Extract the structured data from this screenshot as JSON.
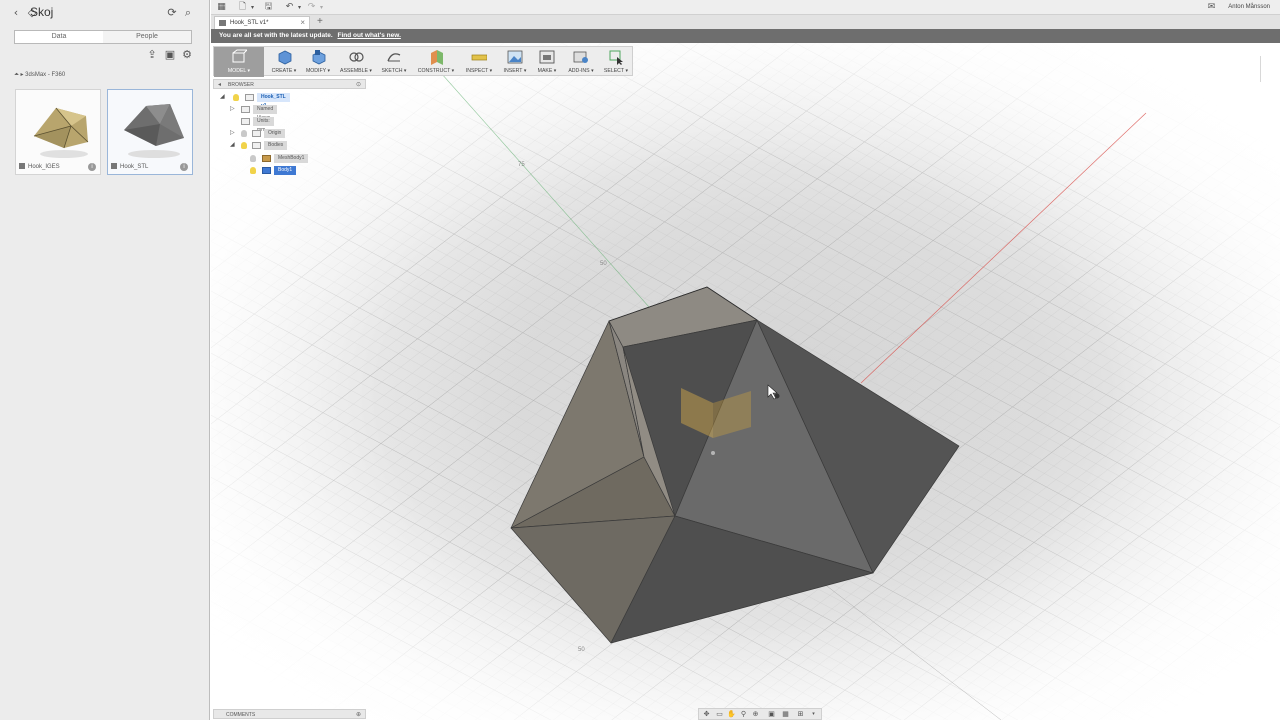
{
  "left_panel": {
    "title": "Skoj",
    "tabs": [
      {
        "label": "Data",
        "active": true
      },
      {
        "label": "People",
        "active": false
      }
    ],
    "breadcrumb": "▸ 3dsMax - F360",
    "files": [
      {
        "name": "Hook_IGES",
        "selected": false
      },
      {
        "name": "Hook_STL",
        "selected": true
      }
    ]
  },
  "topbar": {
    "user_name": "Anton Månsson"
  },
  "document": {
    "tab_label": "Hook_STL v1*",
    "close": "×",
    "new_tab": "+"
  },
  "banner": {
    "text": "You are all set with the latest update.",
    "link": "Find out what's new."
  },
  "toolbar": {
    "tools": [
      {
        "label": "MODEL ▾",
        "icon": "model-workspace-icon"
      },
      {
        "label": "CREATE ▾",
        "icon": "create-cube-icon"
      },
      {
        "label": "MODIFY ▾",
        "icon": "modify-icon"
      },
      {
        "label": "ASSEMBLE ▾",
        "icon": "assemble-icon"
      },
      {
        "label": "SKETCH ▾",
        "icon": "sketch-icon"
      },
      {
        "label": "CONSTRUCT ▾",
        "icon": "construct-plane-icon"
      },
      {
        "label": "INSPECT ▾",
        "icon": "inspect-ruler-icon"
      },
      {
        "label": "INSERT ▾",
        "icon": "insert-image-icon"
      },
      {
        "label": "MAKE ▾",
        "icon": "make-print-icon"
      },
      {
        "label": "ADD-INS ▾",
        "icon": "addins-icon"
      },
      {
        "label": "SELECT ▾",
        "icon": "select-arrow-icon"
      }
    ]
  },
  "browser": {
    "title": "BROWSER",
    "items": [
      {
        "label": "Hook_STL v1",
        "level": 0
      },
      {
        "label": "Named Views",
        "level": 1
      },
      {
        "label": "Units: mm",
        "level": 1
      },
      {
        "label": "Origin",
        "level": 1
      },
      {
        "label": "Bodies",
        "level": 1
      },
      {
        "label": "MeshBody1",
        "level": 2
      },
      {
        "label": "Body1",
        "level": 2
      }
    ]
  },
  "comments": {
    "label": "COMMENTS"
  },
  "viewport": {
    "axis_ticks": [
      "75",
      "50",
      "50"
    ],
    "colors": {
      "mesh_dark": "#4f4f4f",
      "mesh_mid": "#6a6a6a",
      "mesh_light": "#8a8a8a",
      "accent_axis_red": "#d9504c",
      "accent_axis_green": "#4fa860"
    }
  }
}
